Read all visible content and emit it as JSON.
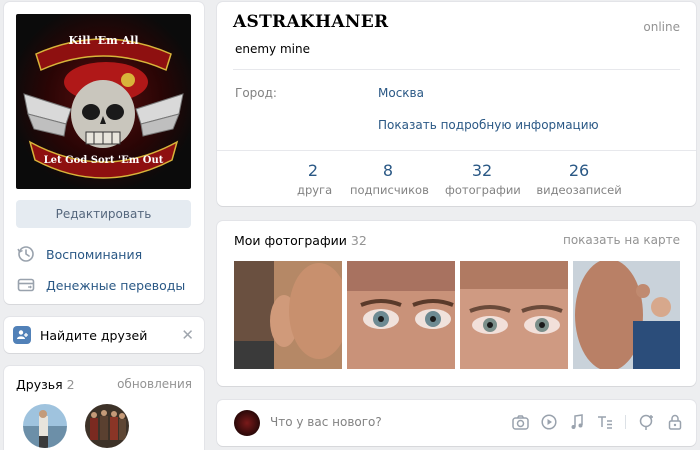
{
  "profile": {
    "name": "ASTRAKHANER",
    "online": "online",
    "status": "enemy mine",
    "city_label": "Город:",
    "city_value": "Москва",
    "more_info": "Показать подробную информацию",
    "avatar_text_top": "Kill 'Em All",
    "avatar_text_bottom": "Let God Sort 'Em Out",
    "counters": [
      {
        "value": "2",
        "label": "друга"
      },
      {
        "value": "8",
        "label": "подписчиков"
      },
      {
        "value": "32",
        "label": "фотографии"
      },
      {
        "value": "26",
        "label": "видеозаписей"
      }
    ]
  },
  "sidebar": {
    "edit_label": "Редактировать",
    "links": [
      {
        "label": "Воспоминания",
        "icon": "history-icon"
      },
      {
        "label": "Денежные переводы",
        "icon": "money-transfer-icon"
      }
    ],
    "find_friends": "Найдите друзей",
    "find_friends_close": "✕"
  },
  "friends": {
    "title": "Друзья",
    "count": "2",
    "updates": "обновления"
  },
  "photos": {
    "title": "Мои фотографии",
    "count": "32",
    "map_link": "показать на карте"
  },
  "post": {
    "placeholder": "Что у вас нового?"
  },
  "colors": {
    "accent": "#2a5885",
    "secondary_text": "#828282",
    "background": "#edeef0",
    "button_bg": "#e5ebf1"
  }
}
